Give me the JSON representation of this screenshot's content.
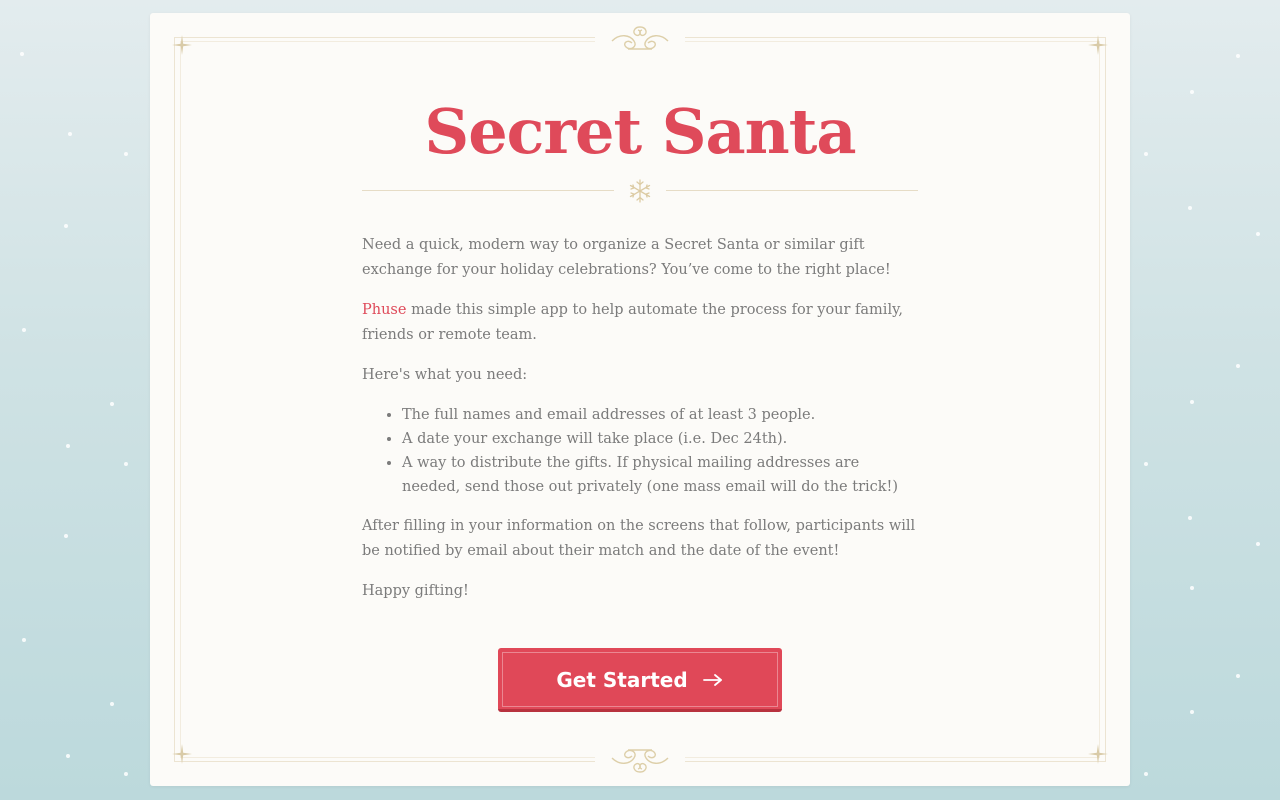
{
  "app": {
    "title": "Secret Santa"
  },
  "intro": {
    "paragraph_1": "Need a quick, modern way to organize a Secret Santa or similar gift exchange for your holiday celebrations? You’ve come to the right place!",
    "phuse_link": "Phuse",
    "paragraph_2_rest": " made this simple app to help automate the process for your family, friends or remote team.",
    "needs_heading": "Here's what you need:",
    "needs": [
      "The full names and email addresses of at least 3 people.",
      "A date your exchange will take place (i.e. Dec 24th).",
      "A way to distribute the gifts. If physical mailing addresses are needed, send those out privately (one mass email will do the trick!)"
    ],
    "paragraph_after": "After filling in your information on the screens that follow, participants will be notified by email about their match and the date of the event!",
    "sign_off": "Happy gifting!"
  },
  "cta": {
    "label": "Get Started",
    "icon": "arrow-right-icon"
  },
  "colors": {
    "accent": "#df4a5a",
    "button": "#e04858",
    "text": "#7b7b7b",
    "ornament": "#ddd0b4"
  }
}
